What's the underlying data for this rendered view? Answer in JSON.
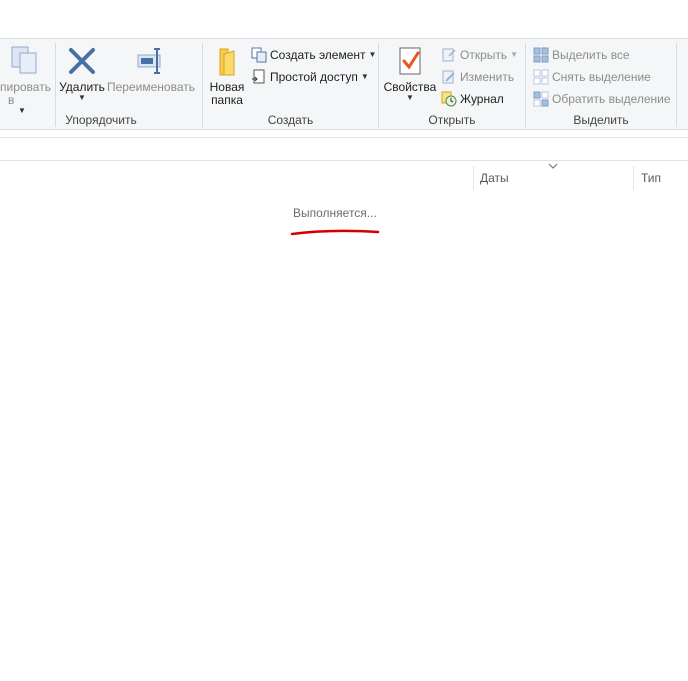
{
  "ribbon": {
    "organize": {
      "label": "Упорядочить",
      "copy_to": {
        "line1": "пировать",
        "line2": "в"
      },
      "delete": "Удалить",
      "rename": "Переименовать"
    },
    "create": {
      "label": "Создать",
      "new_folder": {
        "line1": "Новая",
        "line2": "папка"
      },
      "new_item": "Создать элемент",
      "easy_access": "Простой доступ"
    },
    "open": {
      "label": "Открыть",
      "properties": "Свойства",
      "open": "Открыть",
      "edit": "Изменить",
      "history": "Журнал"
    },
    "select": {
      "label": "Выделить",
      "select_all": "Выделить все",
      "select_none": "Снять выделение",
      "invert": "Обратить выделение"
    }
  },
  "columns": {
    "date": "Даты",
    "type": "Тип"
  },
  "status": "Выполняется...",
  "colors": {
    "accent": "#1979ca",
    "annotation": "#d40000",
    "folder": "#f7c94c",
    "check": "#e8561e"
  }
}
